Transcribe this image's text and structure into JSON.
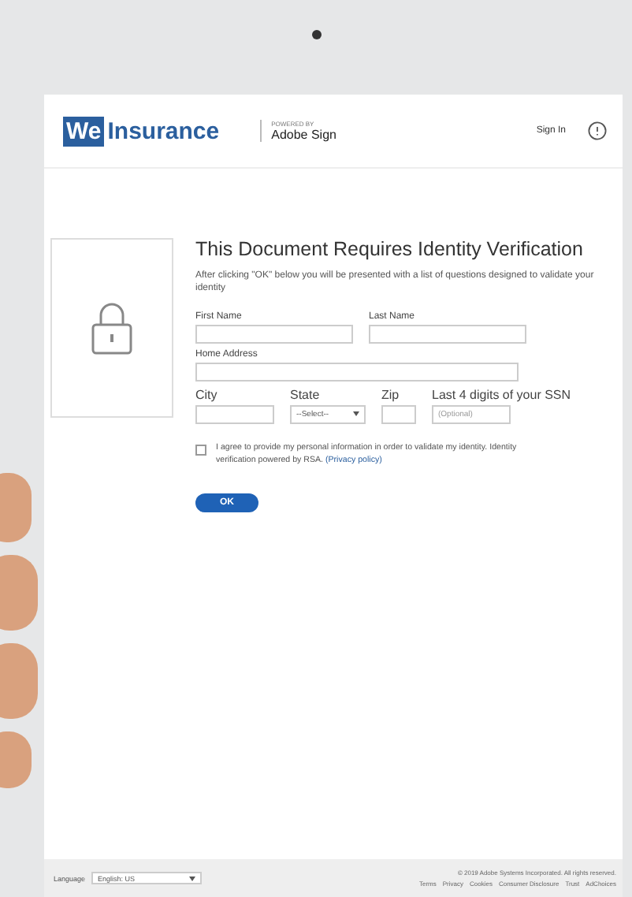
{
  "header": {
    "logo_we": "We",
    "logo_name": "Insurance",
    "powered_by": "POWERED BY",
    "partner": "Adobe Sign",
    "sign_in": "Sign In"
  },
  "title": "This Document Requires Identity Verification",
  "intro": "After clicking \"OK\" below you will be presented with a list of questions designed to validate your identity",
  "field_rows": [
    [
      {
        "label": "First Name",
        "kind": "text"
      },
      {
        "label": "Last Name",
        "kind": "text"
      }
    ],
    [
      {
        "label": "Home Address",
        "kind": "wide"
      }
    ],
    [
      {
        "label": "City",
        "kind": "text"
      },
      {
        "label": "State",
        "kind": "select",
        "value": "--Select--"
      },
      {
        "label": "Zip",
        "kind": "small"
      },
      {
        "label": "Last 4 digits of your SSN",
        "kind": "text",
        "placeholder": "(Optional)"
      }
    ]
  ],
  "consent": {
    "checked": false,
    "text": "I agree to provide my personal information in order to validate my identity. Identity verification powered by RSA.",
    "link": "(Privacy policy)"
  },
  "ok_button": "OK",
  "footer": {
    "language_label": "Language",
    "language": "English: US",
    "copyright": "© 2019 Adobe Systems Incorporated. All rights reserved.",
    "links": [
      "Terms",
      "Privacy",
      "Cookies",
      "Consumer Disclosure",
      "Trust",
      "AdChoices"
    ]
  }
}
